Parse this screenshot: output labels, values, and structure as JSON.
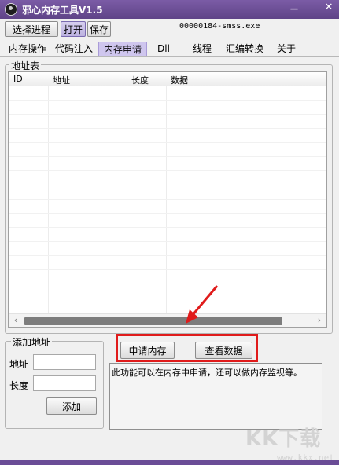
{
  "window": {
    "title": "邪心内存工具V1.5",
    "minimize": "－",
    "close": "✕"
  },
  "toolbar": {
    "select_process": "选择进程",
    "open": "打开",
    "save": "保存",
    "process_label": "00000184-smss.exe"
  },
  "tabs": [
    {
      "label": "内存操作",
      "selected": false
    },
    {
      "label": "代码注入",
      "selected": false
    },
    {
      "label": "内存申请",
      "selected": true
    },
    {
      "label": "Dll",
      "selected": false
    },
    {
      "label": "线程",
      "selected": false
    },
    {
      "label": "汇编转换",
      "selected": false
    },
    {
      "label": "关于",
      "selected": false
    }
  ],
  "address_table": {
    "group_title": "地址表",
    "columns": [
      "ID",
      "地址",
      "长度",
      "数据"
    ],
    "rows": [],
    "scroll_left": "‹",
    "scroll_right": "›"
  },
  "add_address": {
    "group_title": "添加地址",
    "address_label": "地址",
    "address_value": "",
    "length_label": "长度",
    "length_value": "",
    "add_button": "添加"
  },
  "actions": {
    "allocate_memory": "申请内存",
    "view_data": "查看数据"
  },
  "description": "此功能可以在内存中申请，还可以做内存监视等。",
  "annotation": {
    "highlight_color": "#e01b1b"
  },
  "watermark": {
    "logo": "KK下载",
    "url": "www.kkx.net"
  },
  "colors": {
    "titlebar": "#6a4c96",
    "selected_tab": "#cfc6ee"
  }
}
